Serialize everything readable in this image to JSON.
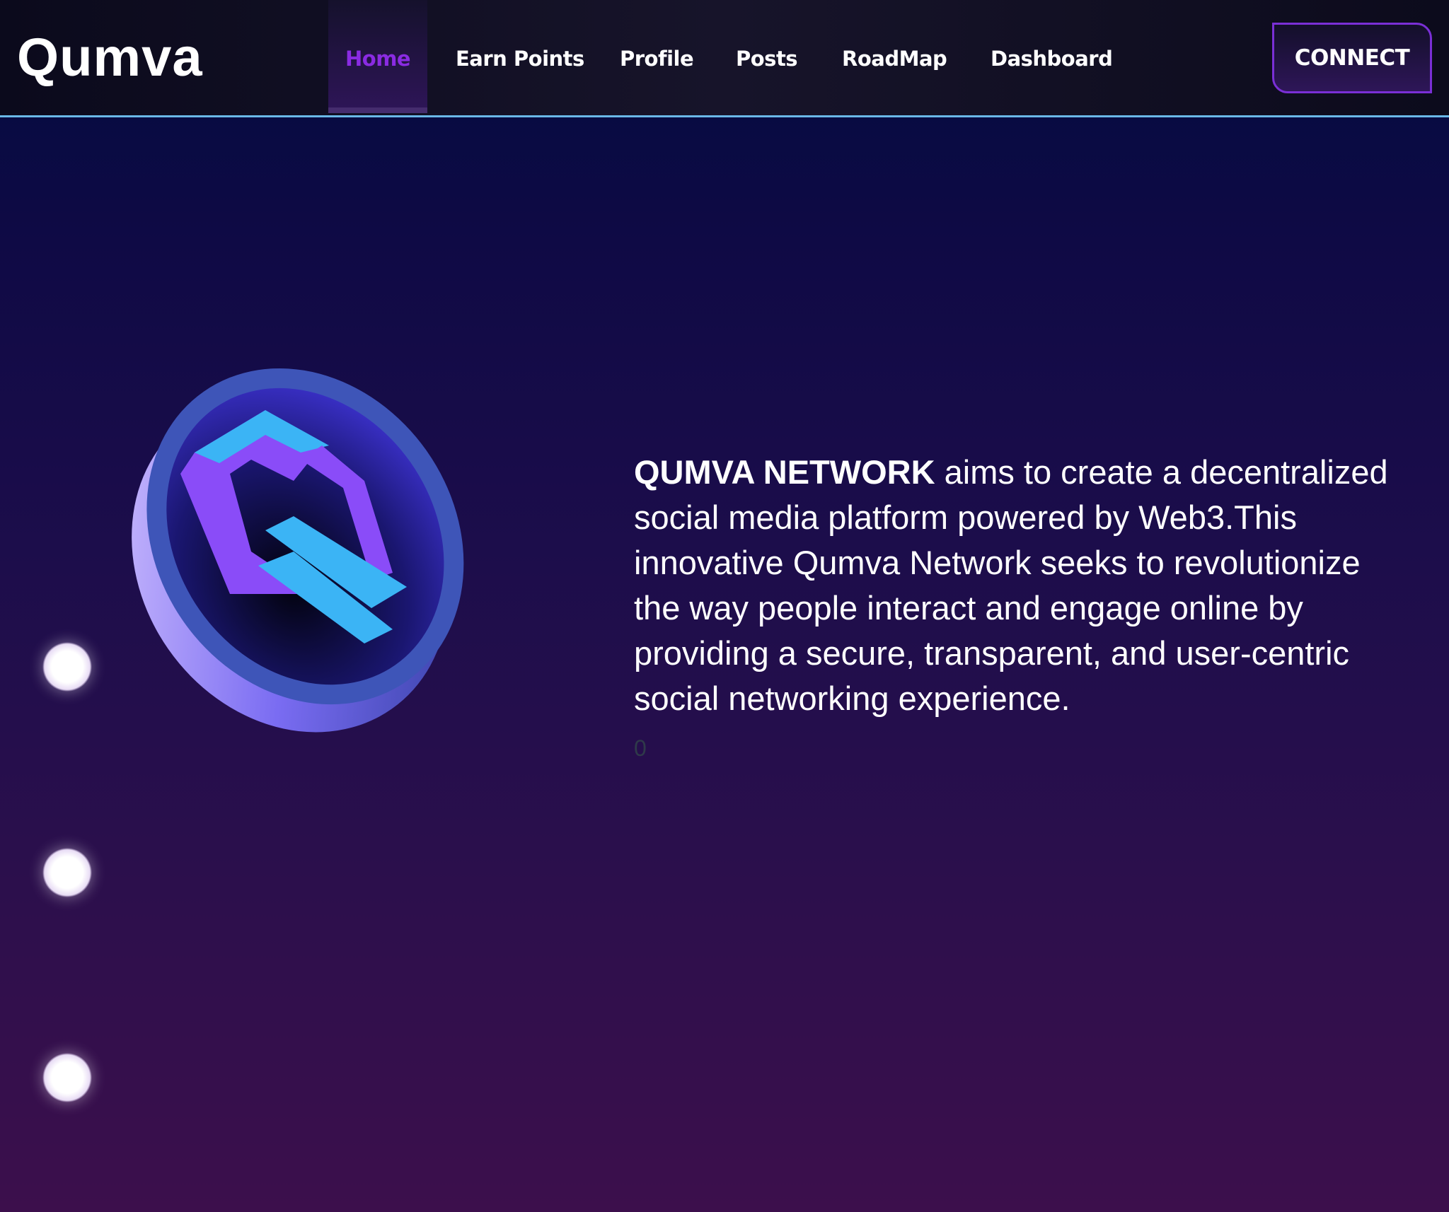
{
  "header": {
    "logo": "Qumva",
    "nav": [
      {
        "label": "Home",
        "active": true
      },
      {
        "label": "Earn Points"
      },
      {
        "label": "Profile"
      },
      {
        "label": "Posts"
      },
      {
        "label": "RoadMap"
      },
      {
        "label": "Dashboard"
      }
    ],
    "connect_label": "CONNECT"
  },
  "hero": {
    "brand": "QUMVA NETWORK",
    "description": " aims to create a decentralized social media platform powered by Web3.This innovative Qumva Network seeks to revolutionize the way people interact and engage online by providing a secure, transparent, and user-centric social networking experience.",
    "counter": "0"
  },
  "colors": {
    "accent": "#8a2be2",
    "nav_border": "#6ab8e8",
    "coin_cyan": "#3bb4f5",
    "coin_purple": "#8a4cf8"
  },
  "icons": {
    "coin": "qumva-coin-logo",
    "dots": "pagination-dot"
  }
}
